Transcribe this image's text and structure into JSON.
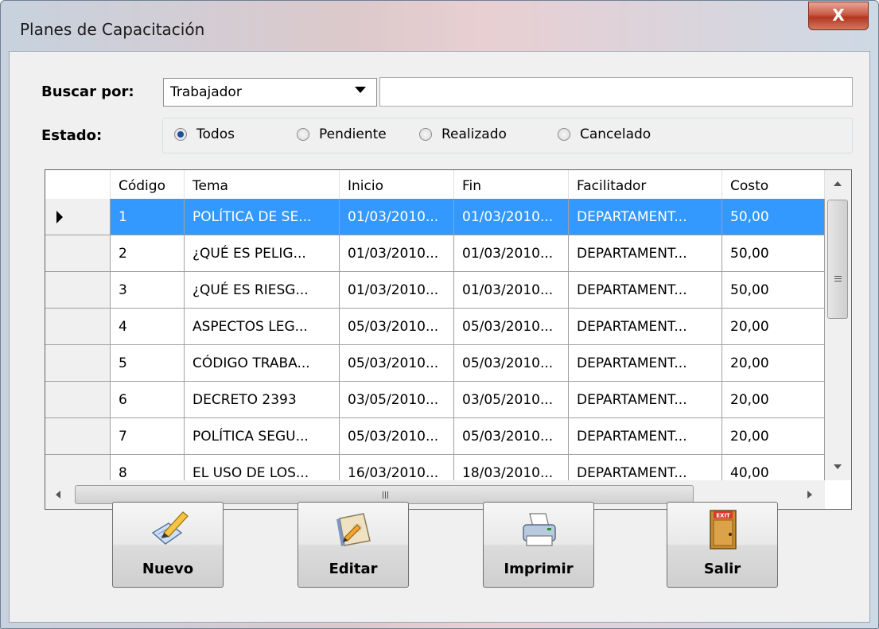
{
  "window": {
    "title": "Planes de Capacitación",
    "close_label": "X"
  },
  "search": {
    "label": "Buscar por:",
    "selected": "Trabajador",
    "value": ""
  },
  "status": {
    "label": "Estado:",
    "options": [
      "Todos",
      "Pendiente",
      "Realizado",
      "Cancelado"
    ],
    "selected": "Todos"
  },
  "grid": {
    "columns": [
      "Código",
      "Tema",
      "Inicio",
      "Fin",
      "Facilitador",
      "Costo"
    ],
    "rows": [
      [
        "1",
        "POLÍTICA DE SE...",
        "01/03/2010...",
        "01/03/2010...",
        "DEPARTAMENT...",
        "50,00"
      ],
      [
        "2",
        "¿QUÉ ES PELIG...",
        "01/03/2010...",
        "01/03/2010...",
        "DEPARTAMENT...",
        "50,00"
      ],
      [
        "3",
        "¿QUÉ ES RIESG...",
        "01/03/2010...",
        "01/03/2010...",
        "DEPARTAMENT...",
        "50,00"
      ],
      [
        "4",
        "ASPECTOS LEG...",
        "05/03/2010...",
        "05/03/2010...",
        "DEPARTAMENT...",
        "20,00"
      ],
      [
        "5",
        "CÓDIGO TRABA...",
        "05/03/2010...",
        "05/03/2010...",
        "DEPARTAMENT...",
        "20,00"
      ],
      [
        "6",
        "DECRETO 2393",
        "03/05/2010...",
        "03/05/2010...",
        "DEPARTAMENT...",
        "20,00"
      ],
      [
        "7",
        "POLÍTICA SEGU...",
        "05/03/2010...",
        "05/03/2010...",
        "DEPARTAMENT...",
        "20,00"
      ],
      [
        "8",
        "EL USO DE LOS...",
        "16/03/2010...",
        "18/03/2010...",
        "DEPARTAMENT...",
        "40,00"
      ]
    ],
    "selected_row": 1
  },
  "buttons": {
    "nuevo": "Nuevo",
    "editar": "Editar",
    "imprimir": "Imprimir",
    "salir": "Salir",
    "exit_sign": "EXIT"
  },
  "colors": {
    "selection": "#3399ff",
    "close_button": "#c95a45"
  }
}
